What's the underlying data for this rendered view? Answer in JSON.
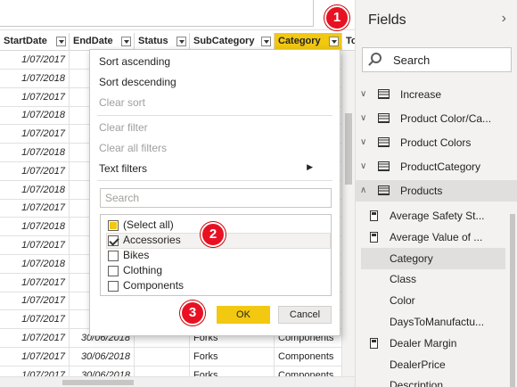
{
  "grid": {
    "columns": [
      "StartDate",
      "EndDate",
      "Status",
      "SubCategory",
      "Category",
      "To"
    ],
    "start_dates": [
      "1/07/2017",
      "1/07/2018",
      "1/07/2017",
      "1/07/2018",
      "1/07/2017",
      "1/07/2018",
      "1/07/2017",
      "1/07/2018",
      "1/07/2017",
      "1/07/2018",
      "1/07/2017",
      "1/07/2018",
      "1/07/2017",
      "1/07/2017",
      "1/07/2017",
      "1/07/2017",
      "1/07/2017",
      "1/07/2017"
    ],
    "bottom_rows": [
      {
        "end_date": "30/06/2018",
        "subcategory": "Forks",
        "category": "Components"
      },
      {
        "end_date": "30/06/2018",
        "subcategory": "Forks",
        "category": "Components"
      },
      {
        "end_date": "30/06/2018",
        "subcategory": "Forks",
        "category": "Components"
      }
    ]
  },
  "dropdown": {
    "sort_ascending": "Sort ascending",
    "sort_descending": "Sort descending",
    "clear_sort": "Clear sort",
    "clear_filter": "Clear filter",
    "clear_all_filters": "Clear all filters",
    "text_filters": "Text filters",
    "search_placeholder": "Search",
    "values": [
      {
        "label": "(Select all)",
        "state": "partial"
      },
      {
        "label": "Accessories",
        "state": "checked"
      },
      {
        "label": "Bikes",
        "state": "unchecked"
      },
      {
        "label": "Clothing",
        "state": "unchecked"
      },
      {
        "label": "Components",
        "state": "unchecked"
      }
    ],
    "ok_label": "OK",
    "cancel_label": "Cancel"
  },
  "markers": [
    "1",
    "2",
    "3"
  ],
  "fields_pane": {
    "title": "Fields",
    "search_label": "Search",
    "tables": [
      {
        "name": "Increase",
        "expanded": false
      },
      {
        "name": "Product Color/Ca...",
        "expanded": false
      },
      {
        "name": "Product Colors",
        "expanded": false
      },
      {
        "name": "ProductCategory",
        "expanded": false
      },
      {
        "name": "Products",
        "expanded": true
      }
    ],
    "fields": [
      {
        "name": "Average Safety St...",
        "icon": "calculator-icon",
        "selected": false
      },
      {
        "name": "Average Value of ...",
        "icon": "calculator-icon",
        "selected": false
      },
      {
        "name": "Category",
        "icon": "",
        "selected": true
      },
      {
        "name": "Class",
        "icon": "",
        "selected": false
      },
      {
        "name": "Color",
        "icon": "",
        "selected": false
      },
      {
        "name": "DaysToManufactu...",
        "icon": "",
        "selected": false
      },
      {
        "name": "Dealer Margin",
        "icon": "calculator-icon",
        "selected": false
      },
      {
        "name": "DealerPrice",
        "icon": "",
        "selected": false
      },
      {
        "name": "Description",
        "icon": "",
        "selected": false
      }
    ]
  },
  "colors": {
    "accent_yellow": "#f2c811",
    "marker_red": "#e81123",
    "pane_bg": "#f3f2f1"
  }
}
